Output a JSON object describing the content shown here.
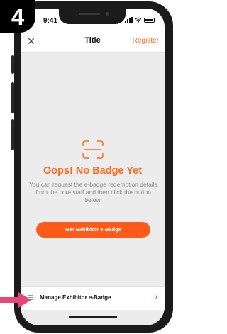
{
  "step_badge": {
    "number": "4"
  },
  "status_bar": {
    "time": "9:41"
  },
  "navbar": {
    "title": "Title",
    "right_action": "Register",
    "left_icon": "close-icon"
  },
  "empty_state": {
    "icon": "scan-icon",
    "title": "Oops! No Badge Yet",
    "description": "You can request the e-badge redemption details from the core staff and then click the button below.",
    "button_label": "Get Exhibitor e-Badge"
  },
  "bottom_bar": {
    "label": "Manage Exhibitor e-Badge",
    "left_icon": "menu-icon",
    "right_icon": "chevron-right-icon"
  },
  "colors": {
    "accent": "#ff6a1a",
    "button": "#ff5a1a",
    "pointer": "#e8457a",
    "background": "#ececec"
  }
}
